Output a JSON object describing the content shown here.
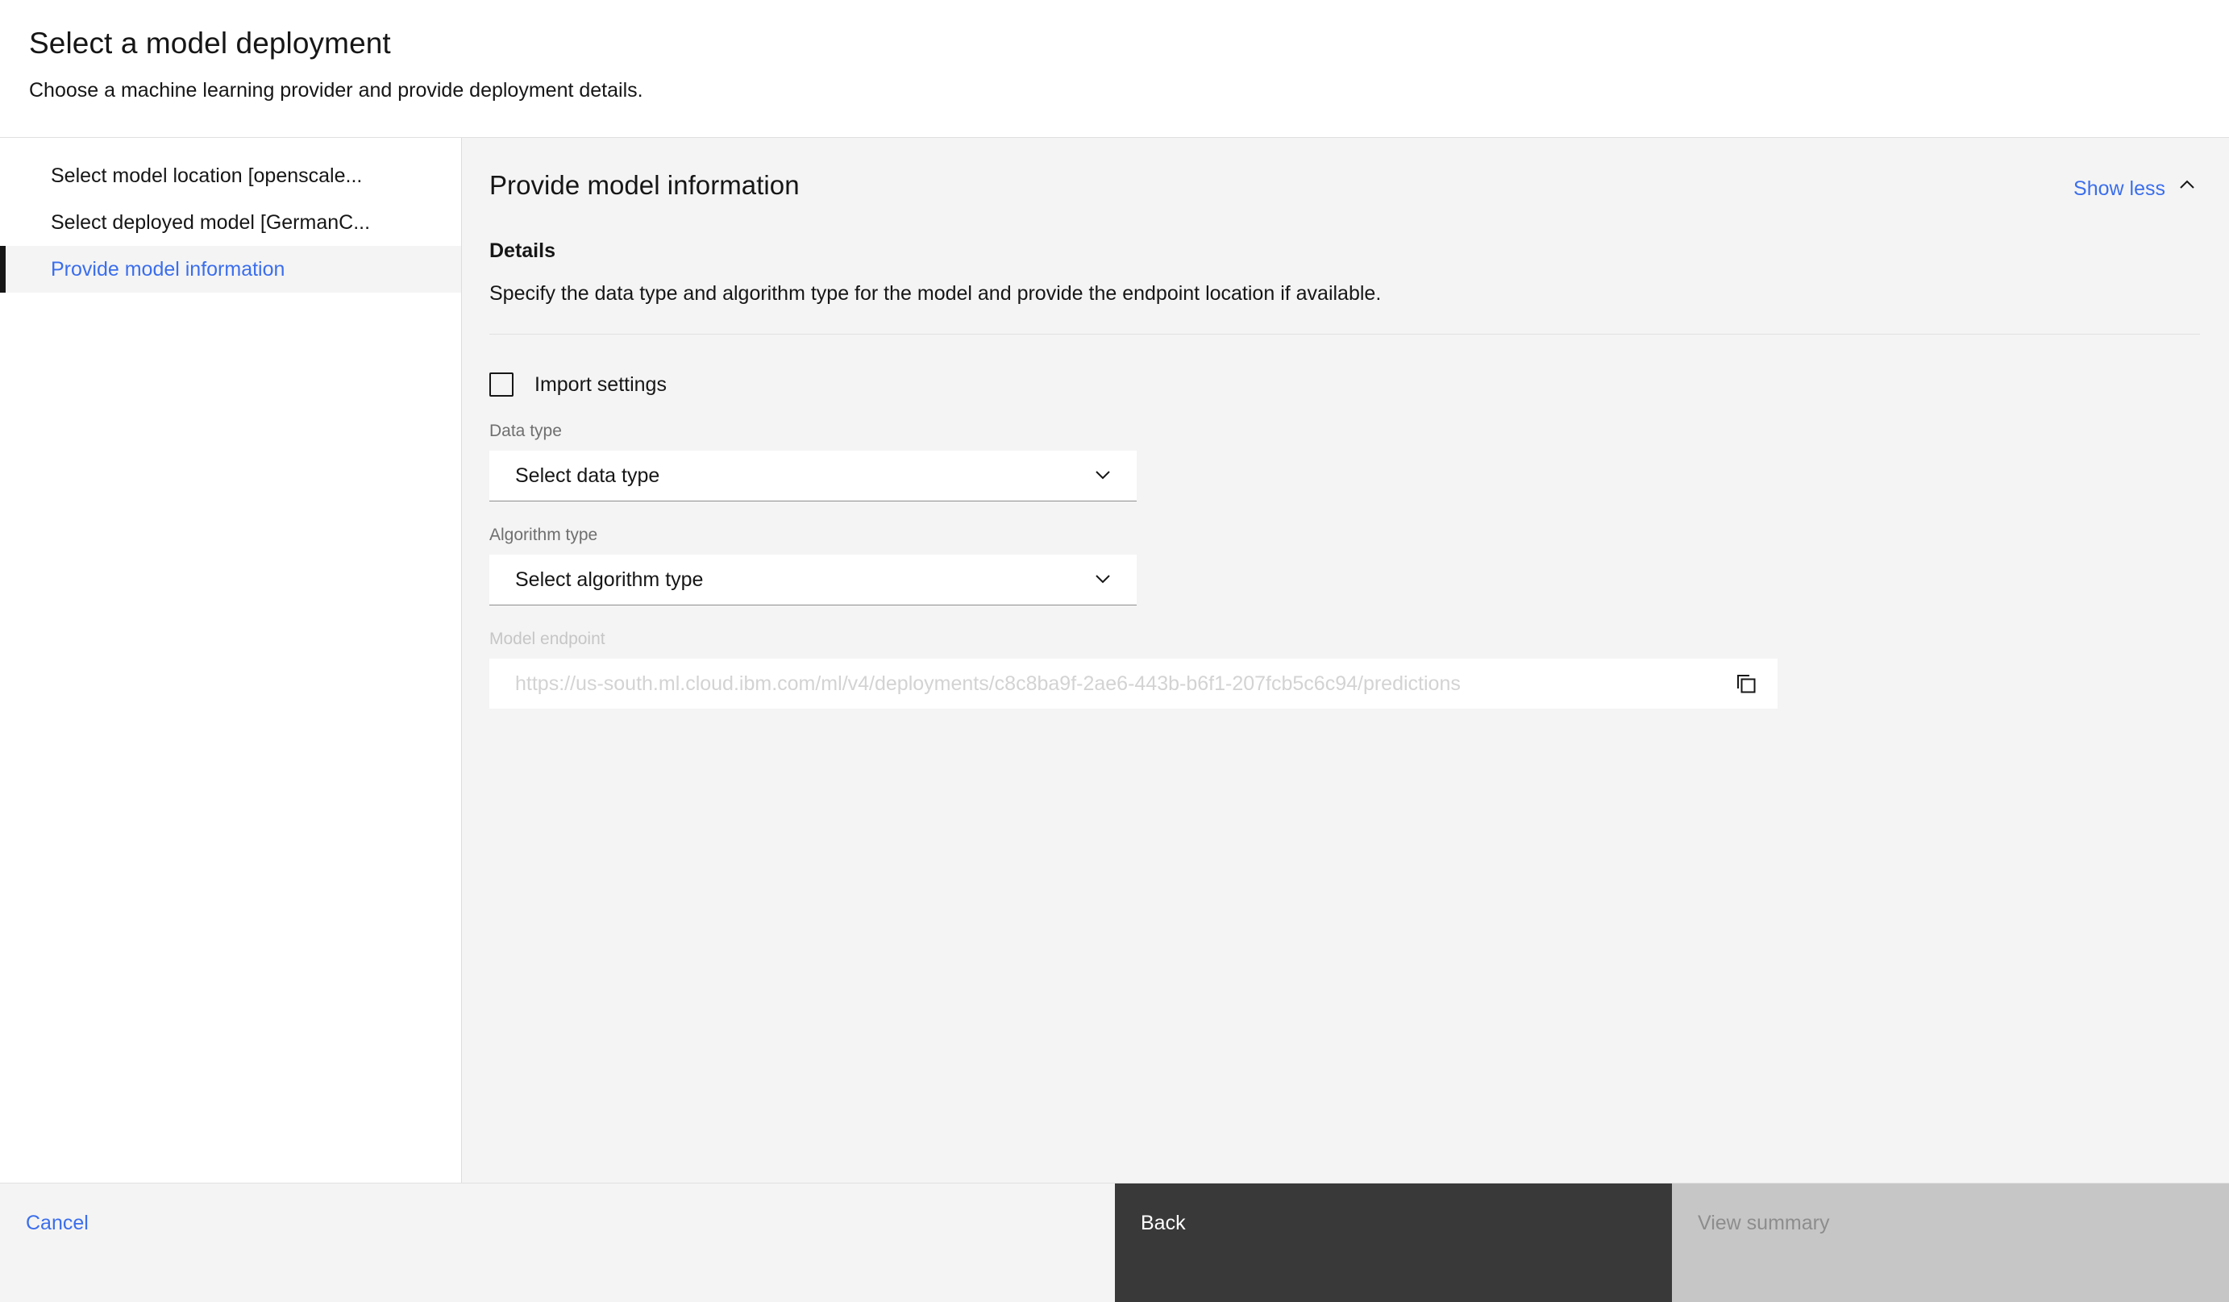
{
  "header": {
    "title": "Select a model deployment",
    "subtitle": "Choose a machine learning provider and provide deployment details."
  },
  "sidebar": {
    "items": [
      {
        "label": "Select model location [openscale...",
        "active": false
      },
      {
        "label": "Select deployed model [GermanC...",
        "active": false
      },
      {
        "label": "Provide model information",
        "active": true
      }
    ]
  },
  "main": {
    "title": "Provide model information",
    "show_less_label": "Show less",
    "show_less_icon": "chevron-up-icon",
    "section": {
      "label": "Details",
      "description": "Specify the data type and algorithm type for the model and provide the endpoint location if available."
    },
    "import_settings": {
      "label": "Import settings",
      "checked": false
    },
    "fields": {
      "data_type": {
        "label": "Data type",
        "value": "Select data type",
        "icon": "chevron-down-icon",
        "disabled": false
      },
      "algorithm_type": {
        "label": "Algorithm type",
        "value": "Select algorithm type",
        "icon": "chevron-down-icon",
        "disabled": false
      },
      "model_endpoint": {
        "label": "Model endpoint",
        "placeholder": "https://us-south.ml.cloud.ibm.com/ml/v4/deployments/c8c8ba9f-2ae6-443b-b6f1-207fcb5c6c94/predictions",
        "value": "",
        "copy_icon": "copy-icon",
        "disabled": true
      }
    }
  },
  "footer": {
    "cancel_label": "Cancel",
    "back_label": "Back",
    "view_summary_label": "View summary",
    "view_summary_disabled": true
  },
  "colors": {
    "accent_link": "#3b6eec",
    "active_indicator": "#161616",
    "primary_button_bg": "#393939",
    "disabled_button_bg": "#c6c6c6",
    "panel_bg": "#f4f4f4"
  }
}
